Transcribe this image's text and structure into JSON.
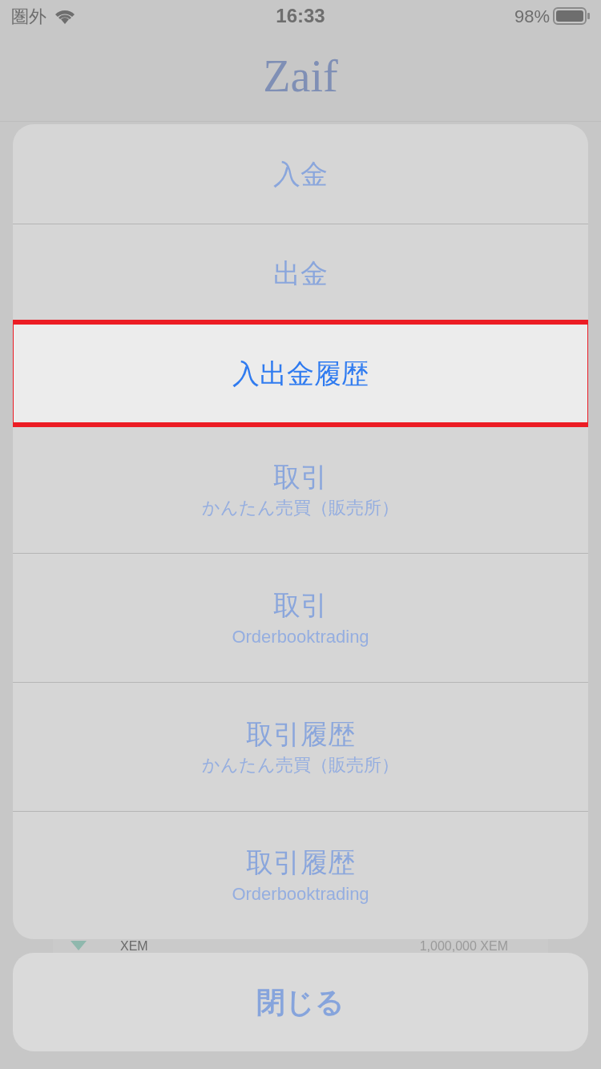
{
  "status_bar": {
    "carrier": "圏外",
    "time": "16:33",
    "battery": "98%"
  },
  "header": {
    "logo": "Zaif"
  },
  "background_row": {
    "name": "XEM",
    "amount": "1,000,000 XEM"
  },
  "action_sheet": {
    "items": [
      {
        "title": "入金",
        "selected": false
      },
      {
        "title": "出金",
        "selected": false
      },
      {
        "title": "入出金履歴",
        "selected": true
      },
      {
        "title": "取引",
        "subtitle": "かんたん売買（販売所）",
        "selected": false
      },
      {
        "title": "取引",
        "subtitle": "Orderbooktrading",
        "selected": false
      },
      {
        "title": "取引履歴",
        "subtitle": "かんたん売買（販売所）",
        "selected": false
      },
      {
        "title": "取引履歴",
        "subtitle": "Orderbooktrading",
        "selected": false
      }
    ],
    "cancel": "閉じる"
  }
}
